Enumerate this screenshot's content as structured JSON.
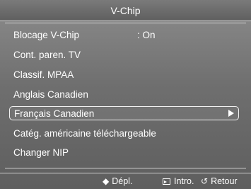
{
  "title": "V-Chip",
  "menu": {
    "items": [
      {
        "label": "Blocage V-Chip",
        "value": ": On"
      },
      {
        "label": "Cont. paren. TV"
      },
      {
        "label": "Classif. MPAA"
      },
      {
        "label": "Anglais Canadien"
      },
      {
        "label": "Français Canadien",
        "selected": true,
        "has_submenu": true
      },
      {
        "label": "Catég. américaine téléchargeable"
      },
      {
        "label": "Changer NIP"
      }
    ]
  },
  "footer": {
    "move": {
      "icon": "updown-icon",
      "glyph": "◆",
      "label": "Dépl."
    },
    "enter": {
      "icon": "enter-icon",
      "label": "Intro."
    },
    "return": {
      "icon": "return-icon",
      "glyph": "↺",
      "label": "Retour"
    }
  }
}
